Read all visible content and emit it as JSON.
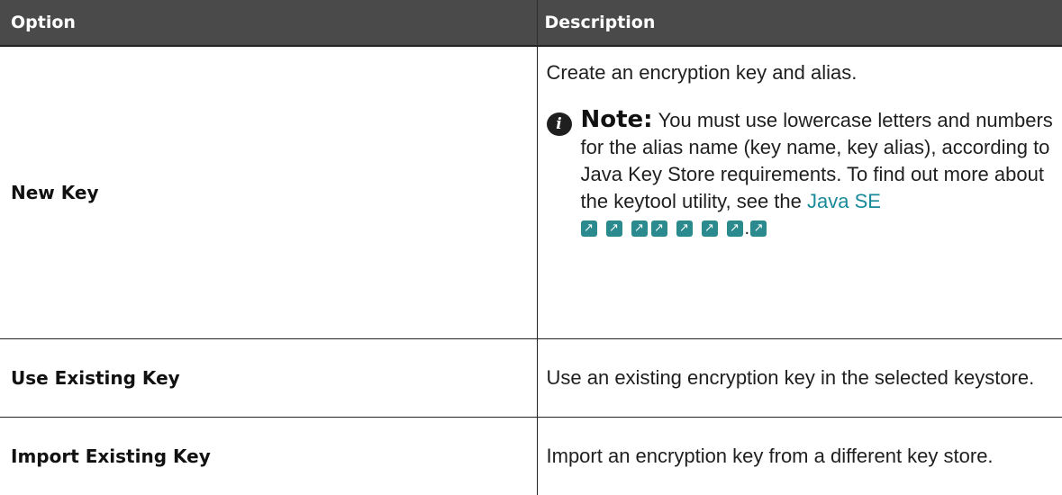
{
  "header": {
    "option": "Option",
    "description": "Description"
  },
  "rows": [
    {
      "option": "New Key",
      "description": "Create an encryption key and alias.",
      "note": {
        "label": "Note:",
        "text": "You must use lowercase letters and numbers for the alias name (key name, key alias), according to Java Key Store requirements. To find out more about the keytool utility, see the ",
        "link_text": "Java SE",
        "icon": "info-icon",
        "link_icon": "external-link-icon"
      }
    },
    {
      "option": "Use Existing Key",
      "description": "Use an existing encryption key in the selected keystore."
    },
    {
      "option": "Import Existing Key",
      "description": "Import an encryption key from a different key store."
    }
  ],
  "colors": {
    "header_bg": "#4a4a4a",
    "link": "#1a8a9a",
    "link_icon_bg": "#2b8a8e"
  }
}
